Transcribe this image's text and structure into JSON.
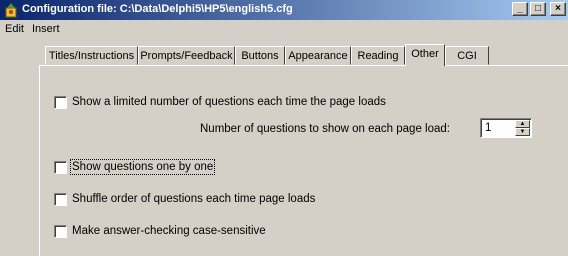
{
  "window": {
    "title": "Configuration file: C:\\Data\\Delphi5\\HP5\\english5.cfg",
    "minimize_symbol": "_",
    "maximize_symbol": "□",
    "close_symbol": "×"
  },
  "menu": {
    "items": [
      "Edit",
      "Insert"
    ]
  },
  "tabs": [
    {
      "label": "Titles/Instructions"
    },
    {
      "label": "Prompts/Feedback"
    },
    {
      "label": "Buttons"
    },
    {
      "label": "Appearance"
    },
    {
      "label": "Reading"
    },
    {
      "label": "Other",
      "active": true
    },
    {
      "label": "CGI"
    }
  ],
  "options": {
    "limit_questions": {
      "label": "Show a limited number of questions each time the page loads",
      "checked": false
    },
    "questions_count": {
      "label": "Number of questions to show on each page load:",
      "value": "1"
    },
    "one_by_one": {
      "label": "Show questions one by one",
      "checked": false
    },
    "shuffle_order": {
      "label": "Shuffle order of questions each time page loads",
      "checked": false
    },
    "case_sensitive": {
      "label": "Make answer-checking case-sensitive",
      "checked": false
    }
  },
  "icons": {
    "app": "hotpotatoes-app-icon",
    "spin_up": "spin-up-icon",
    "spin_down": "spin-down-icon"
  },
  "colors": {
    "titlebar_start": "#0a246a",
    "titlebar_end": "#a6caf0",
    "face": "#d4d0c8"
  }
}
